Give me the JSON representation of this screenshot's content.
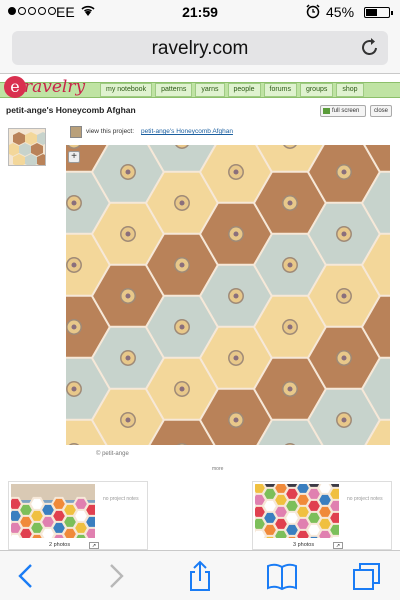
{
  "status": {
    "carrier": "EE",
    "time": "21:59",
    "battery": "45%",
    "battery_level": 0.45
  },
  "browser": {
    "url": "ravelry.com"
  },
  "site": {
    "logo_text": "ravelry",
    "nav": [
      "my notebook",
      "patterns",
      "yarns",
      "people",
      "forums",
      "groups",
      "shop"
    ]
  },
  "project": {
    "title": "petit-ange's Honeycomb Afghan",
    "full_screen_label": "full screen",
    "close_label": "close",
    "view_label": "view this project:",
    "view_link": "petit-ange's Honeycomb Afghan",
    "zoom_label": "+",
    "credit": "© petit-ange"
  },
  "cards": [
    {
      "photos": "2 photos",
      "note": "no project notes",
      "more": "↗"
    },
    {
      "photos": "3 photos",
      "note": "no project notes",
      "more": "↗"
    }
  ],
  "more_label": "more",
  "colors": {
    "nav_green": "#bfe3a3",
    "logo_red": "#c8234a",
    "hex_brown": "#b98259",
    "hex_yellow": "#f3d79a",
    "hex_blue": "#c7d3cc",
    "seam": "#f6e8d8",
    "link_blue": "#1b5fa0"
  }
}
